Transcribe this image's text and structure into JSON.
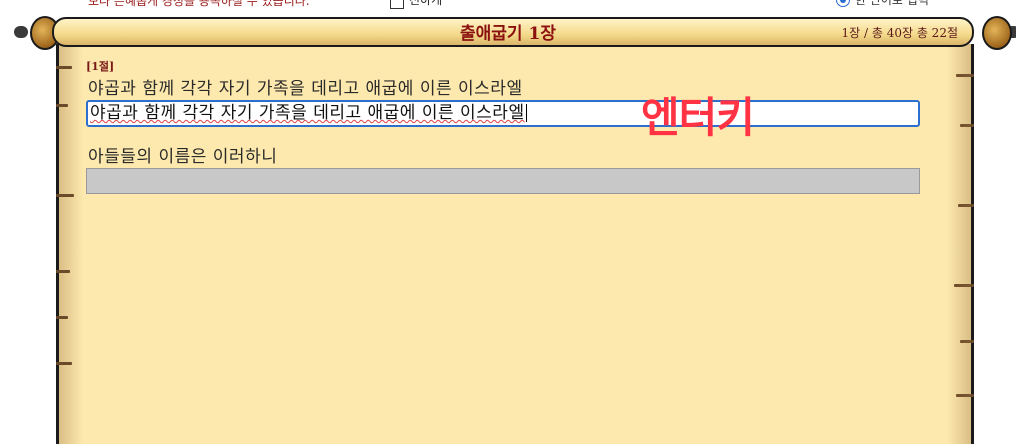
{
  "top_strip": {
    "notice": "보다 은혜롭게 경청을 용독하실 수 있습니다.",
    "checkbox_label": "진하게",
    "radio_label": "한 단어로 입력"
  },
  "header": {
    "title": "출애굽기 1장",
    "info": "1장 / 총 40장   총 22절"
  },
  "verse": {
    "number": "[1절]",
    "line1": "야곱과 함께 각각 자기 가족을 데리고 애굽에 이른 이스라엘",
    "line2": "아들들의 이름은 이러하니"
  },
  "input": {
    "typed_value": "야곱과 함께 각각 자기 가족을 데리고 애굽에 이른 이스라엘",
    "next_value": ""
  },
  "hint": {
    "text": "엔터키",
    "color": "#ff3344"
  },
  "colors": {
    "paper": "#fde9ad",
    "title": "#8b1010",
    "focus_border": "#2d6fcf"
  }
}
